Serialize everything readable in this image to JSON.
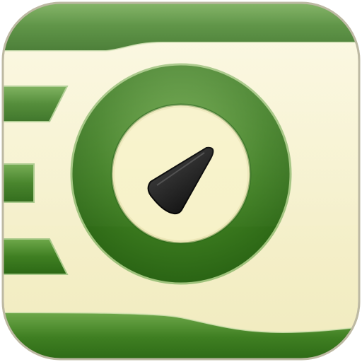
{
  "app_icon": {
    "name": "clock-gauge-app-icon",
    "colors": {
      "background": "#f6f1c4",
      "background_light": "#fbf8dc",
      "green_dark": "#2f6d1a",
      "green_mid": "#4f8f2e",
      "green_light": "#7fb55a",
      "needle": "#111111",
      "outline": "#c9c6b2"
    },
    "needle_direction": "up-right",
    "icon_names": [
      "clock-ring-icon",
      "gauge-needle-icon",
      "speed-lines-icon"
    ]
  }
}
